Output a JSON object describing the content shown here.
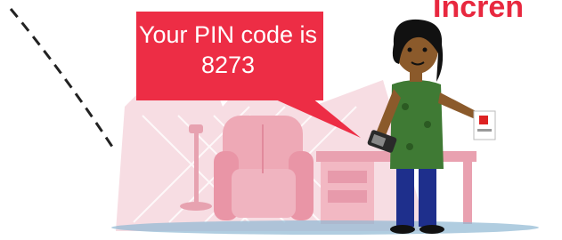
{
  "heading": "Incren",
  "speech_bubble": "Your PIN code is 8273",
  "colors": {
    "accent_red": "#e8283f",
    "furniture_pink": "#eea9b6",
    "wall_pink": "#f7dde3",
    "shirt_green": "#3f7a34",
    "pants_blue": "#1e2f8c"
  },
  "icons": [
    "mobile-phone-icon",
    "card-icon"
  ]
}
